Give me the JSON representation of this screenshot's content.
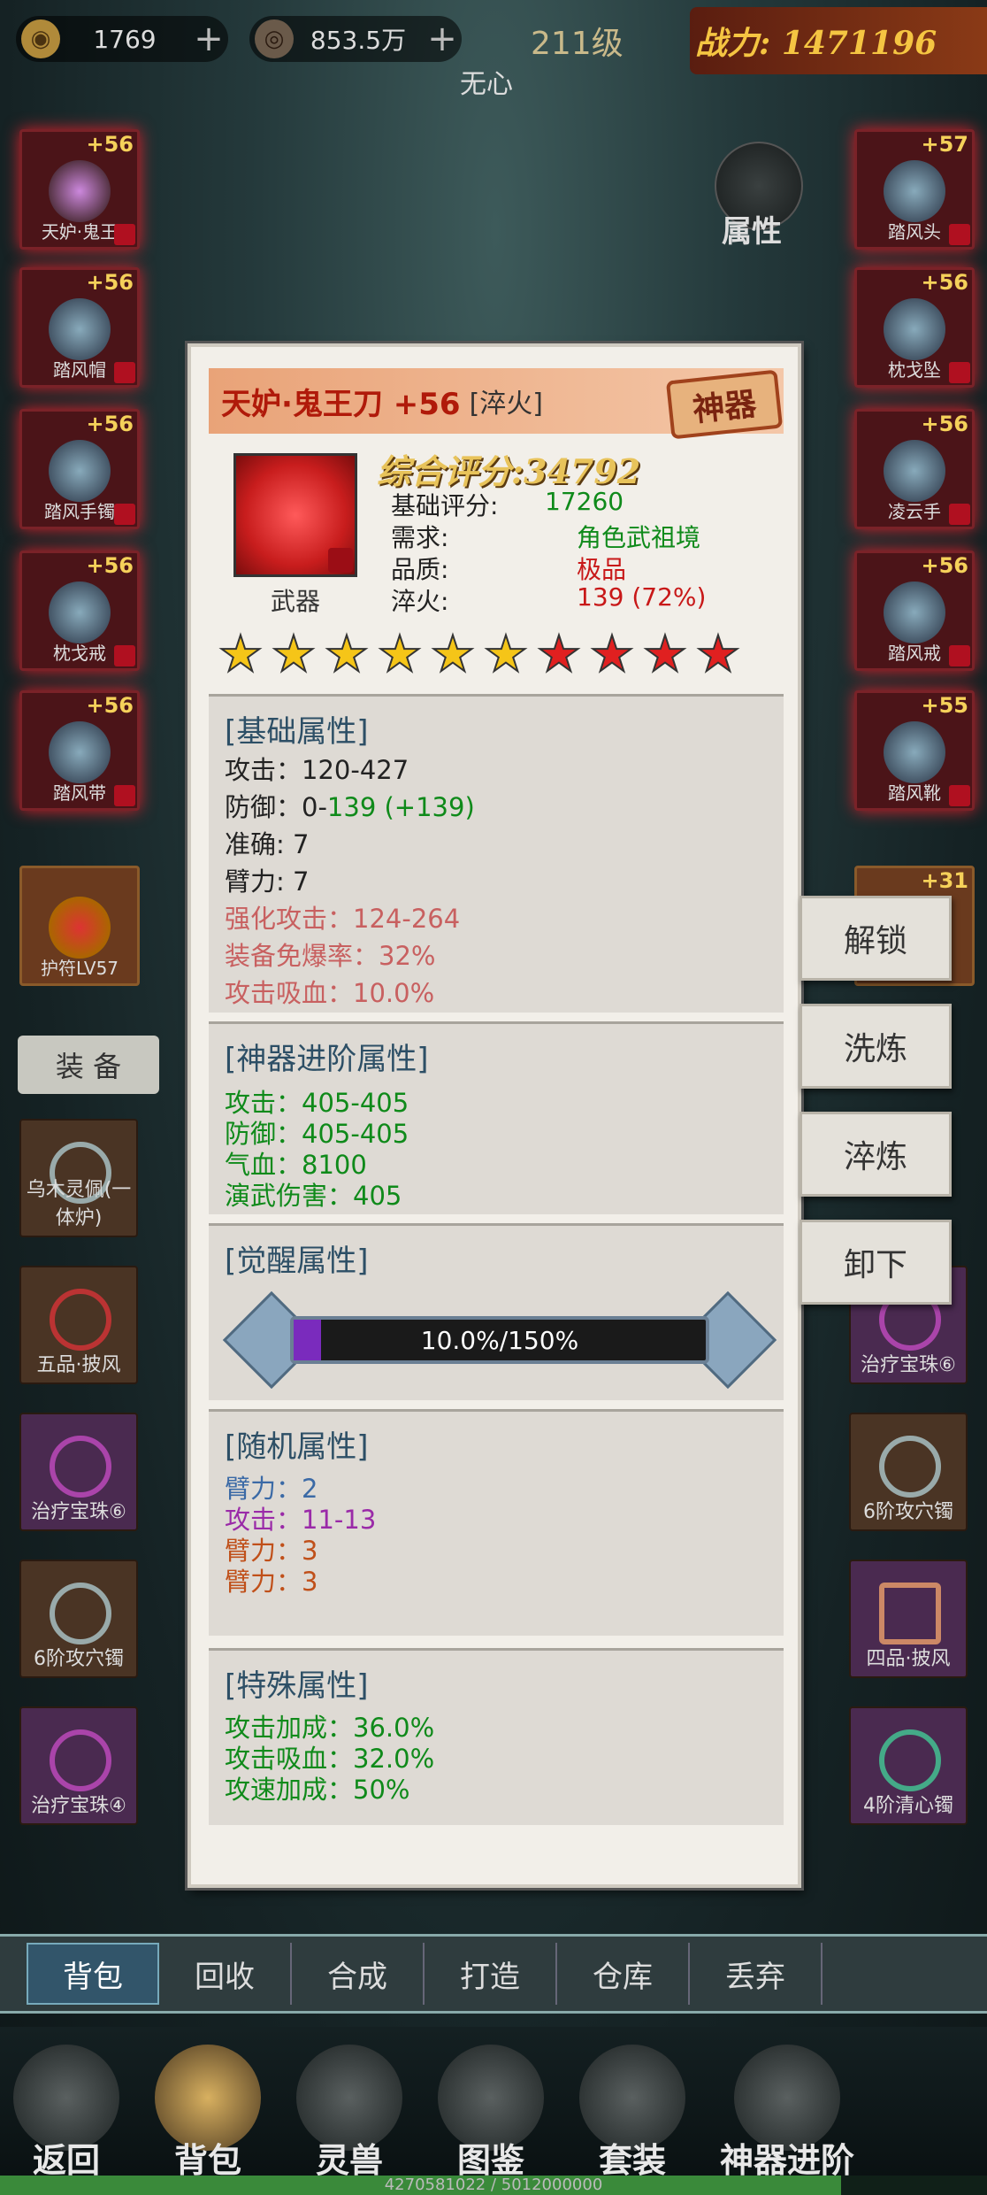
{
  "topbar": {
    "ingots": "1769",
    "coins": "853.5万",
    "level": "211级",
    "power": "战力: 1471196",
    "character_name": "无心"
  },
  "side": {
    "attr_label": "属性"
  },
  "left_slots": [
    {
      "level": "+56",
      "name": "天妒·鬼王"
    },
    {
      "level": "+56",
      "name": "踏风帽"
    },
    {
      "level": "+56",
      "name": "踏风手镯"
    },
    {
      "level": "+56",
      "name": "枕戈戒"
    },
    {
      "level": "+56",
      "name": "踏风带"
    }
  ],
  "right_slots": [
    {
      "level": "+57",
      "name": "踏风头"
    },
    {
      "level": "+56",
      "name": "枕戈坠"
    },
    {
      "level": "+56",
      "name": "凌云手"
    },
    {
      "level": "+56",
      "name": "踏风戒"
    },
    {
      "level": "+55",
      "name": "踏风靴"
    }
  ],
  "amulet": {
    "name": "护符LV57",
    "right_level": "+31"
  },
  "equip_tab": "装 备",
  "bag_items": [
    {
      "name": "乌木灵佩(一体炉)"
    },
    {
      "name": "五品·披风"
    },
    {
      "name": "治疗宝珠⑥"
    },
    {
      "name": "治疗宝珠⑥"
    },
    {
      "name": "6阶攻穴镯"
    },
    {
      "name": "6阶攻穴镯"
    },
    {
      "name": "四品·披风"
    },
    {
      "name": "治疗宝珠④"
    },
    {
      "name": "4阶清心镯"
    }
  ],
  "popup": {
    "item_name": "天妒·鬼王刀 +56",
    "tag": "[淬火]",
    "badge": "神器",
    "icon_label": "武器",
    "total_score": "综合评分:34792",
    "rows": [
      {
        "k": "基础评分:",
        "v": "17260"
      },
      {
        "k": "需求:",
        "v": "角色武祖境"
      },
      {
        "k": "品质:",
        "v": "极品"
      },
      {
        "k": "淬火:",
        "v": "139 (72%)"
      }
    ],
    "stars_gold": 6,
    "stars_red": 4,
    "base_title": "[基础属性]",
    "base_attack": "攻击：120-427",
    "base_defense_a": "防御：0-",
    "base_defense_b": "139 (+139)",
    "base_accuracy": "准确: 7",
    "base_arm": "臂力: 7",
    "base_enh_attack": "强化攻击：124-264",
    "base_crit_immune": "装备免爆率：32%",
    "base_lifesteal": "攻击吸血：10.0%",
    "adv_title": "[神器进阶属性]",
    "adv_attack": "攻击：405-405",
    "adv_defense": "防御：405-405",
    "adv_hp": "气血：8100",
    "adv_dmg": "演武伤害：405",
    "awake_title": "[觉醒属性]",
    "awake_progress": 0.0667,
    "awake_text": "10.0%/150%",
    "random_title": "[随机属性]",
    "random_1": "臂力：2",
    "random_2": "攻击：11-13",
    "random_3": "臂力：3",
    "random_4": "臂力：3",
    "special_title": "[特殊属性]",
    "special_1": "攻击加成：36.0%",
    "special_2": "攻击吸血：32.0%",
    "special_3": "攻速加成：50%"
  },
  "actions": {
    "unlock": "解锁",
    "refine": "洗炼",
    "temper": "淬炼",
    "unequip": "卸下"
  },
  "bottom_tabs": [
    "背包",
    "回收",
    "合成",
    "打造",
    "仓库",
    "丢弃"
  ],
  "nav": [
    "返回",
    "背包",
    "灵兽",
    "图鉴",
    "套装",
    "神器进阶"
  ],
  "exp": {
    "text": "4270581022 / 5012000000",
    "progress": 0.852
  }
}
